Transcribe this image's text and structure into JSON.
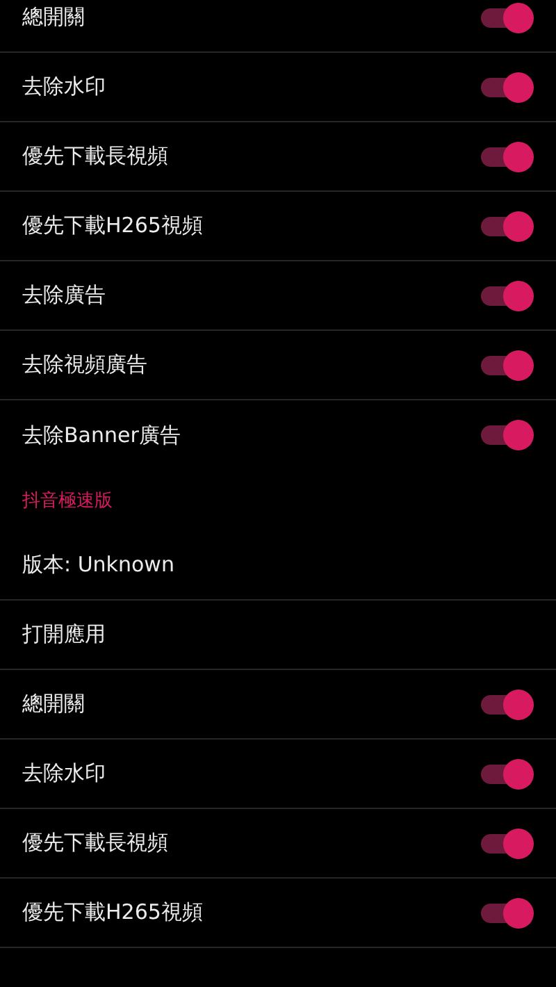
{
  "items": [
    {
      "kind": "toggle",
      "label": "總開關",
      "on": true
    },
    {
      "kind": "toggle",
      "label": "去除水印",
      "on": true
    },
    {
      "kind": "toggle",
      "label": "優先下載長視頻",
      "on": true
    },
    {
      "kind": "toggle",
      "label": "優先下載H265視頻",
      "on": true
    },
    {
      "kind": "toggle",
      "label": "去除廣告",
      "on": true
    },
    {
      "kind": "toggle",
      "label": "去除視頻廣告",
      "on": true
    },
    {
      "kind": "toggle",
      "label": "去除Banner廣告",
      "on": true
    },
    {
      "kind": "header",
      "label": "抖音極速版"
    },
    {
      "kind": "info",
      "label": "版本: Unknown"
    },
    {
      "kind": "action",
      "label": "打開應用"
    },
    {
      "kind": "toggle",
      "label": "總開關",
      "on": true
    },
    {
      "kind": "toggle",
      "label": "去除水印",
      "on": true
    },
    {
      "kind": "toggle",
      "label": "優先下載長視頻",
      "on": true
    },
    {
      "kind": "toggle",
      "label": "優先下載H265視頻",
      "on": true
    }
  ]
}
